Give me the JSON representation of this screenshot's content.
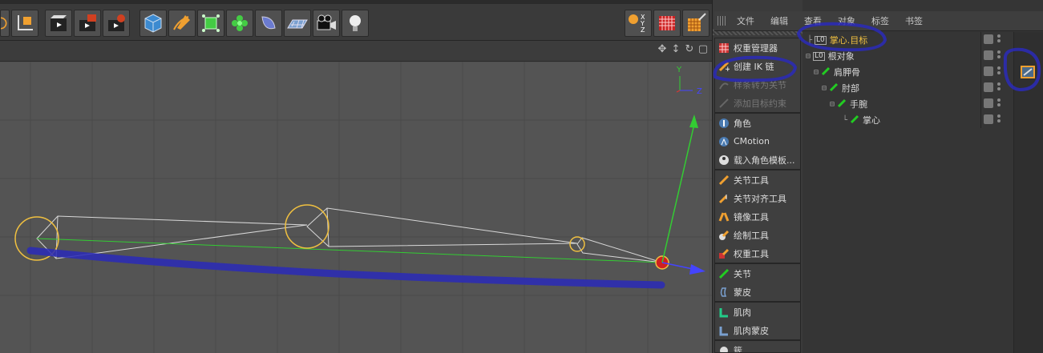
{
  "toolbar": {
    "groups": [
      {
        "name": "transform",
        "icons": [
          "rotate-tool-icon",
          "coordinate-system-icon"
        ]
      },
      {
        "name": "render",
        "icons": [
          "render-view-icon",
          "render-to-picture-viewer-icon",
          "render-settings-icon"
        ]
      },
      {
        "name": "objects",
        "icons": [
          "cube-primitive-icon",
          "spline-pen-icon",
          "subdivision-generator-icon",
          "cloner-mograph-icon",
          "deformer-icon",
          "floor-environment-icon",
          "camera-icon",
          "light-icon"
        ]
      },
      {
        "name": "right",
        "icons": [
          "axis-lock-icon",
          "texture-checker-icon",
          "paint-brush-icon"
        ]
      }
    ],
    "axis_labels": [
      "X",
      "Y",
      "Z"
    ]
  },
  "viewport": {
    "axis_labels": {
      "y": "Y",
      "z": "Z"
    }
  },
  "palette": {
    "group1": [
      {
        "label": "权重管理器",
        "icon": "weight-manager-icon",
        "enabled": true
      },
      {
        "label": "创建 IK 链",
        "icon": "create-ik-chain-icon",
        "enabled": true
      },
      {
        "label": "样条转为关节",
        "icon": "spline-to-joints-icon",
        "enabled": false
      },
      {
        "label": "添加目标约束",
        "icon": "add-target-constraint-icon",
        "enabled": false
      }
    ],
    "group2": [
      {
        "label": "角色",
        "icon": "character-icon",
        "enabled": true
      },
      {
        "label": "CMotion",
        "icon": "cmotion-icon",
        "enabled": true
      },
      {
        "label": "载入角色模板...",
        "icon": "load-character-template-icon",
        "enabled": true
      }
    ],
    "group3": [
      {
        "label": "关节工具",
        "icon": "joint-tool-icon",
        "enabled": true
      },
      {
        "label": "关节对齐工具",
        "icon": "joint-align-tool-icon",
        "enabled": true
      },
      {
        "label": "镜像工具",
        "icon": "mirror-tool-icon",
        "enabled": true
      },
      {
        "label": "绘制工具",
        "icon": "draw-tool-icon",
        "enabled": true
      },
      {
        "label": "权重工具",
        "icon": "weight-tool-icon",
        "enabled": true
      }
    ],
    "group4": [
      {
        "label": "关节",
        "icon": "joint-icon",
        "enabled": true
      },
      {
        "label": "蒙皮",
        "icon": "skin-icon",
        "enabled": true
      }
    ],
    "group5": [
      {
        "label": "肌肉",
        "icon": "muscle-icon",
        "enabled": true
      },
      {
        "label": "肌肉蒙皮",
        "icon": "muscle-skin-icon",
        "enabled": true
      }
    ],
    "group6": [
      {
        "label": "簇",
        "icon": "cluster-icon",
        "enabled": true
      }
    ]
  },
  "object_manager": {
    "menu": [
      "文件",
      "编辑",
      "查看",
      "对象",
      "标签",
      "书签"
    ],
    "rows": [
      {
        "tree": "├",
        "name": "掌心.目标",
        "icon": "null-object-icon",
        "selected": true
      },
      {
        "tree": "⊟",
        "name": "根对象",
        "icon": "null-object-icon",
        "selected": false
      },
      {
        "tree": "  ⊟",
        "name": "肩胛骨",
        "icon": "joint-icon",
        "selected": false
      },
      {
        "tree": "    ⊟",
        "name": "肘部",
        "icon": "joint-icon",
        "selected": false
      },
      {
        "tree": "      ⊟",
        "name": "手腕",
        "icon": "joint-icon",
        "selected": false
      },
      {
        "tree": "        └",
        "name": "掌心",
        "icon": "joint-icon",
        "selected": false
      }
    ],
    "tags": [
      "ik-tag-icon"
    ]
  }
}
